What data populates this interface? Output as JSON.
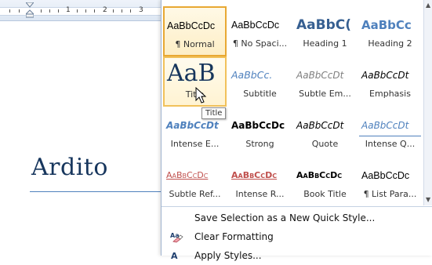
{
  "ruler": {
    "numbers": [
      "1",
      "2",
      "3"
    ]
  },
  "document": {
    "heading": "Ardito"
  },
  "gallery": {
    "styles": [
      {
        "preview": "AaBbCcDc",
        "label": "¶ Normal",
        "kind": "normal",
        "state": "selected"
      },
      {
        "preview": "AaBbCcDc",
        "label": "¶ No Spaci...",
        "kind": "normal",
        "state": ""
      },
      {
        "preview": "AaBbC(",
        "label": "Heading 1",
        "kind": "heading",
        "state": ""
      },
      {
        "preview": "AaBbCc",
        "label": "Heading 2",
        "kind": "heading2",
        "state": ""
      },
      {
        "preview": "AaB",
        "label": "Title",
        "kind": "title",
        "state": "hovered"
      },
      {
        "preview": "AaBbCc.",
        "label": "Subtitle",
        "kind": "subtitle",
        "state": ""
      },
      {
        "preview": "AaBbCcDt",
        "label": "Subtle Em...",
        "kind": "subtle",
        "state": ""
      },
      {
        "preview": "AaBbCcDt",
        "label": "Emphasis",
        "kind": "emph",
        "state": ""
      },
      {
        "preview": "AaBbCcDt",
        "label": "Intense E...",
        "kind": "intense",
        "state": ""
      },
      {
        "preview": "AaBbCcDc",
        "label": "Strong",
        "kind": "strong",
        "state": ""
      },
      {
        "preview": "AaBbCcDt",
        "label": "Quote",
        "kind": "quote",
        "state": ""
      },
      {
        "preview": "AaBbCcDt",
        "label": "Intense Q...",
        "kind": "iquote",
        "state": ""
      },
      {
        "preview": "AaBbCcDc",
        "label": "Subtle Ref...",
        "kind": "subref",
        "state": ""
      },
      {
        "preview": "AaBbCcDc",
        "label": "Intense R...",
        "kind": "intref",
        "state": ""
      },
      {
        "preview": "AaBbCcDc",
        "label": "Book Title",
        "kind": "book",
        "state": ""
      },
      {
        "preview": "AaBbCcDc",
        "label": "¶ List Para...",
        "kind": "list",
        "state": ""
      }
    ],
    "tooltip": "Title"
  },
  "menu": {
    "save_selection": "Save Selection as a New Quick Style...",
    "clear_formatting": "Clear Formatting",
    "apply_styles": "Apply Styles..."
  },
  "colors": {
    "selected_border": "#e8a833",
    "heading_blue": "#365f91",
    "reference_red": "#c0504d"
  }
}
